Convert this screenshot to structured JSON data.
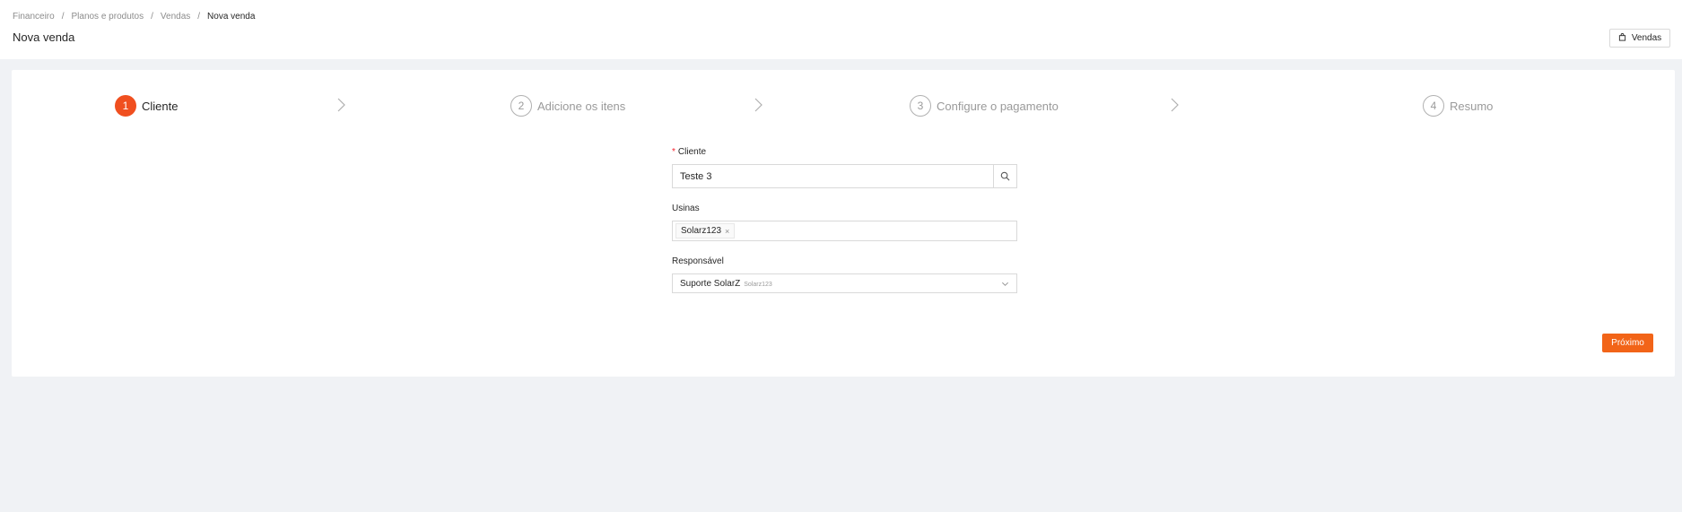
{
  "breadcrumb": [
    "Financeiro",
    "Planos e produtos",
    "Vendas",
    "Nova venda"
  ],
  "page_title": "Nova venda",
  "vendas_button": {
    "label": "Vendas",
    "icon": "shopping-bag-icon"
  },
  "steps": [
    {
      "number": "1",
      "label": "Cliente",
      "status": "active"
    },
    {
      "number": "2",
      "label": "Adicione os itens",
      "status": "pending"
    },
    {
      "number": "3",
      "label": "Configure o pagamento",
      "status": "pending"
    },
    {
      "number": "4",
      "label": "Resumo",
      "status": "pending"
    }
  ],
  "form": {
    "cliente": {
      "label": "Cliente",
      "required_mark": "*",
      "value": "Teste 3",
      "icon": "search-icon"
    },
    "usinas": {
      "label": "Usinas",
      "tags": [
        "Solarz123"
      ],
      "remove_symbol": "×"
    },
    "responsavel": {
      "label": "Responsável",
      "value": "Suporte SolarZ",
      "sub_value": "Solarz123",
      "icon": "chevron-down-icon"
    }
  },
  "next_button": {
    "label": "Próximo"
  },
  "colors": {
    "accent": "#f04f1f",
    "button": "#f26418",
    "background": "#f0f2f5"
  }
}
